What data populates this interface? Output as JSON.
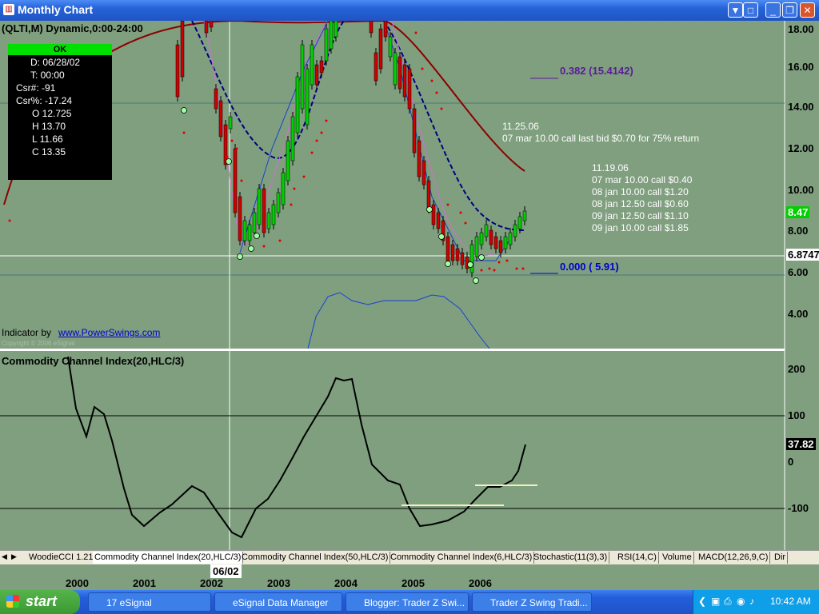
{
  "window": {
    "title": "Monthly Chart"
  },
  "chart_header": {
    "symbol": "(QLTI,M) Dynamic,0:00-24:00"
  },
  "infobox": {
    "status": "OK",
    "rows": [
      "D: 06/28/02",
      "T: 00:00",
      "Csr#: -91",
      "Csr%: -17.24",
      "O 12.725",
      "H 13.70",
      "L 11.66",
      "C 13.35"
    ]
  },
  "price_axis": {
    "ticks": [
      "18.00",
      "16.00",
      "14.00",
      "12.00",
      "10.00",
      "8.00",
      "6.00",
      "4.00"
    ],
    "cursor_value": "6.8747",
    "last_value": "8.47"
  },
  "fib_levels": {
    "upper": "0.382 (15.4142)",
    "lower": "0.000 ( 5.91)"
  },
  "notes": {
    "n1": [
      "11.25.06",
      "07 mar 10.00 call last bid $0.70 for 75% return"
    ],
    "n2": [
      "11.19.06",
      "07 mar 10.00 call $0.40",
      "08 jan 10.00 call $1.20",
      "08 jan 12.50 call $0.60",
      "09 jan 12.50 call $1.10",
      "09 jan 10.00 call $1.85"
    ]
  },
  "indicator": {
    "by_label": "Indicator by",
    "link": "www.PowerSwings.com",
    "copyright": "Copyright © 2006 eSignal"
  },
  "cci_panel": {
    "title": "Commodity Channel Index(20,HLC/3)",
    "ticks": [
      "200",
      "100",
      "0",
      "-100"
    ],
    "last_value": "37.82"
  },
  "tabs": [
    "WoodieCCI 1.21",
    "Commodity Channel Index(20,HLC/3)",
    "Commodity Channel Index(50,HLC/3)",
    "Commodity Channel Index(6,HLC/3)",
    "Stochastic(11(3),3)",
    "RSI(14,C)",
    "Volume",
    "MACD(12,26,9,C)",
    "Dir"
  ],
  "date_axis": {
    "labels": [
      "2000",
      "2001",
      "2002",
      "2003",
      "2004",
      "2005",
      "2006"
    ],
    "cursor_label": "06/02"
  },
  "taskbar": {
    "start": "start",
    "items": [
      "17 eSignal",
      "eSignal Data Manager",
      "Blogger: Trader Z Swi...",
      "Trader Z Swing Tradi..."
    ],
    "clock": "10:42 AM"
  },
  "colors": {
    "chart_bg": "#7f9f7f",
    "up_candle": "#00d000",
    "down_candle": "#d00000",
    "cci_line": "#000000",
    "ma_long": "#8b0000",
    "ma_dash": "#000080"
  }
}
